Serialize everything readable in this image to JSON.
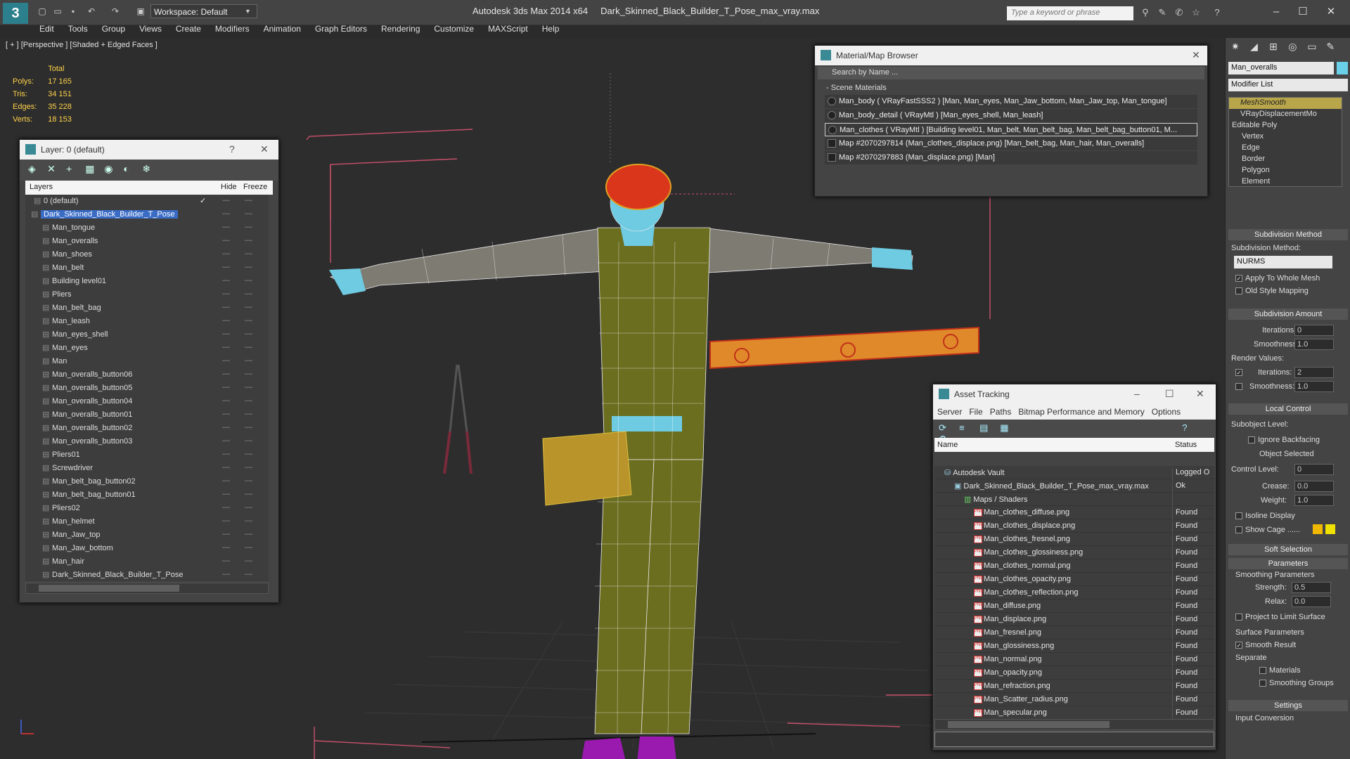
{
  "app": {
    "title": "Autodesk 3ds Max  2014 x64",
    "file": "Dark_Skinned_Black_Builder_T_Pose_max_vray.max",
    "workspace": "Workspace: Default",
    "search_placeholder": "Type a keyword or phrase",
    "menu": [
      "Edit",
      "Tools",
      "Group",
      "Views",
      "Create",
      "Modifiers",
      "Animation",
      "Graph Editors",
      "Rendering",
      "Customize",
      "MAXScript",
      "Help"
    ]
  },
  "viewport": {
    "label": "[ + ] [Perspective ] [Shaded + Edged Faces ]",
    "stats": {
      "header": "Total",
      "rows": [
        {
          "label": "Polys:",
          "value": "17 165"
        },
        {
          "label": "Tris:",
          "value": "34 151"
        },
        {
          "label": "Edges:",
          "value": "35 228"
        },
        {
          "label": "Verts:",
          "value": "18 153"
        }
      ]
    }
  },
  "layers": {
    "title": "Layer: 0 (default)",
    "help": "?",
    "close": "✕",
    "col_layers": "Layers",
    "col_hide": "Hide",
    "col_freeze": "Freeze",
    "rows": [
      "0 (default)",
      "Dark_Skinned_Black_Builder_T_Pose",
      "Man_tongue",
      "Man_overalls",
      "Man_shoes",
      "Man_belt",
      "Building level01",
      "Pliers",
      "Man_belt_bag",
      "Man_leash",
      "Man_eyes_shell",
      "Man_eyes",
      "Man",
      "Man_overalls_button06",
      "Man_overalls_button05",
      "Man_overalls_button04",
      "Man_overalls_button01",
      "Man_overalls_button02",
      "Man_overalls_button03",
      "Pliers01",
      "Screwdriver",
      "Man_belt_bag_button02",
      "Man_belt_bag_button01",
      "Pliers02",
      "Man_helmet",
      "Man_Jaw_top",
      "Man_Jaw_bottom",
      "Man_hair",
      "Dark_Skinned_Black_Builder_T_Pose"
    ]
  },
  "material_browser": {
    "title": "Material/Map Browser",
    "search": "Search by Name ...",
    "section": "- Scene Materials",
    "rows": [
      "Man_body  ( VRayFastSSS2 ) [Man, Man_eyes, Man_Jaw_bottom, Man_Jaw_top, Man_tongue]",
      "Man_body_detail  ( VRayMtl ) [Man_eyes_shell, Man_leash]",
      "Man_clothes  ( VRayMtl ) [Building level01, Man_belt, Man_belt_bag, Man_belt_bag_button01, M...",
      "Map #2070297814 (Man_clothes_displace.png) [Man_belt_bag, Man_hair, Man_overalls]",
      "Map #2070297883 (Man_displace.png) [Man]"
    ]
  },
  "asset_tracking": {
    "title": "Asset Tracking",
    "menu": [
      "Server",
      "File",
      "Paths",
      "Bitmap Performance and Memory",
      "Options"
    ],
    "col_name": "Name",
    "col_status": "Status",
    "rows": [
      {
        "name": "Autodesk Vault",
        "status": "Logged O",
        "indent": 1,
        "icon": "vault"
      },
      {
        "name": "Dark_Skinned_Black_Builder_T_Pose_max_vray.max",
        "status": "Ok",
        "indent": 2,
        "icon": "file"
      },
      {
        "name": "Maps / Shaders",
        "status": "",
        "indent": 3,
        "icon": "maps"
      },
      {
        "name": "Man_clothes_diffuse.png",
        "status": "Found",
        "indent": 4,
        "icon": "png"
      },
      {
        "name": "Man_clothes_displace.png",
        "status": "Found",
        "indent": 4,
        "icon": "png"
      },
      {
        "name": "Man_clothes_fresnel.png",
        "status": "Found",
        "indent": 4,
        "icon": "png"
      },
      {
        "name": "Man_clothes_glossiness.png",
        "status": "Found",
        "indent": 4,
        "icon": "png"
      },
      {
        "name": "Man_clothes_normal.png",
        "status": "Found",
        "indent": 4,
        "icon": "png"
      },
      {
        "name": "Man_clothes_opacity.png",
        "status": "Found",
        "indent": 4,
        "icon": "png"
      },
      {
        "name": "Man_clothes_reflection.png",
        "status": "Found",
        "indent": 4,
        "icon": "png"
      },
      {
        "name": "Man_diffuse.png",
        "status": "Found",
        "indent": 4,
        "icon": "png"
      },
      {
        "name": "Man_displace.png",
        "status": "Found",
        "indent": 4,
        "icon": "png"
      },
      {
        "name": "Man_fresnel.png",
        "status": "Found",
        "indent": 4,
        "icon": "png"
      },
      {
        "name": "Man_glossiness.png",
        "status": "Found",
        "indent": 4,
        "icon": "png"
      },
      {
        "name": "Man_normal.png",
        "status": "Found",
        "indent": 4,
        "icon": "png"
      },
      {
        "name": "Man_opacity.png",
        "status": "Found",
        "indent": 4,
        "icon": "png"
      },
      {
        "name": "Man_refraction.png",
        "status": "Found",
        "indent": 4,
        "icon": "png"
      },
      {
        "name": "Man_Scatter_radius.png",
        "status": "Found",
        "indent": 4,
        "icon": "png"
      },
      {
        "name": "Man_specular.png",
        "status": "Found",
        "indent": 4,
        "icon": "png"
      }
    ]
  },
  "command_panel": {
    "object_name": "Man_overalls",
    "object_color": "#6ad0e8",
    "modifier_list": "Modifier List",
    "stack": [
      {
        "label": "MeshSmooth",
        "highlight": true
      },
      {
        "label": "VRayDisplacementMo",
        "highlight": false
      },
      {
        "label": "Editable Poly",
        "highlight": false
      },
      {
        "label": "Vertex",
        "highlight": false
      },
      {
        "label": "Edge",
        "highlight": false
      },
      {
        "label": "Border",
        "highlight": false
      },
      {
        "label": "Polygon",
        "highlight": false
      },
      {
        "label": "Element",
        "highlight": false
      }
    ],
    "subdiv_method_title": "Subdivision Method",
    "subdiv_method_label": "Subdivision Method:",
    "subdiv_method_value": "NURMS",
    "apply_whole_mesh": "Apply To Whole Mesh",
    "old_style_mapping": "Old Style Mapping",
    "subdiv_amount_title": "Subdivision Amount",
    "iterations_label": "Iterations:",
    "iterations_value": "0",
    "smoothness_label": "Smoothness:",
    "smoothness_value": "1.0",
    "render_values": "Render Values:",
    "render_iterations_value": "2",
    "render_smoothness_value": "1.0",
    "local_control_title": "Local Control",
    "subobject_level": "Subobject Level:",
    "ignore_backfacing": "Ignore Backfacing",
    "object_selected": "Object Selected",
    "control_level": "Control Level:",
    "control_level_value": "0",
    "crease": "Crease:",
    "crease_value": "0.0",
    "weight": "Weight:",
    "weight_value": "1.0",
    "isoline_display": "Isoline Display",
    "show_cage": "Show Cage ......",
    "cage_color_1": "#f0b800",
    "cage_color_2": "#f0e000",
    "soft_selection_title": "Soft Selection",
    "parameters_title": "Parameters",
    "smoothing_params": "Smoothing Parameters",
    "strength": "Strength:",
    "strength_value": "0.5",
    "relax": "Relax:",
    "relax_value": "0.0",
    "project_limit": "Project to Limit Surface",
    "surface_params": "Surface Parameters",
    "smooth_result": "Smooth Result",
    "separate": "Separate",
    "materials": "Materials",
    "smoothing_groups": "Smoothing Groups",
    "settings_title": "Settings",
    "input_conversion": "Input Conversion"
  },
  "colors": {
    "accent": "#3a6cc6",
    "teal": "#2c7f8c",
    "wire": "#ffffff",
    "helmet": "#d9361c",
    "overalls": "#6b6d1f"
  }
}
